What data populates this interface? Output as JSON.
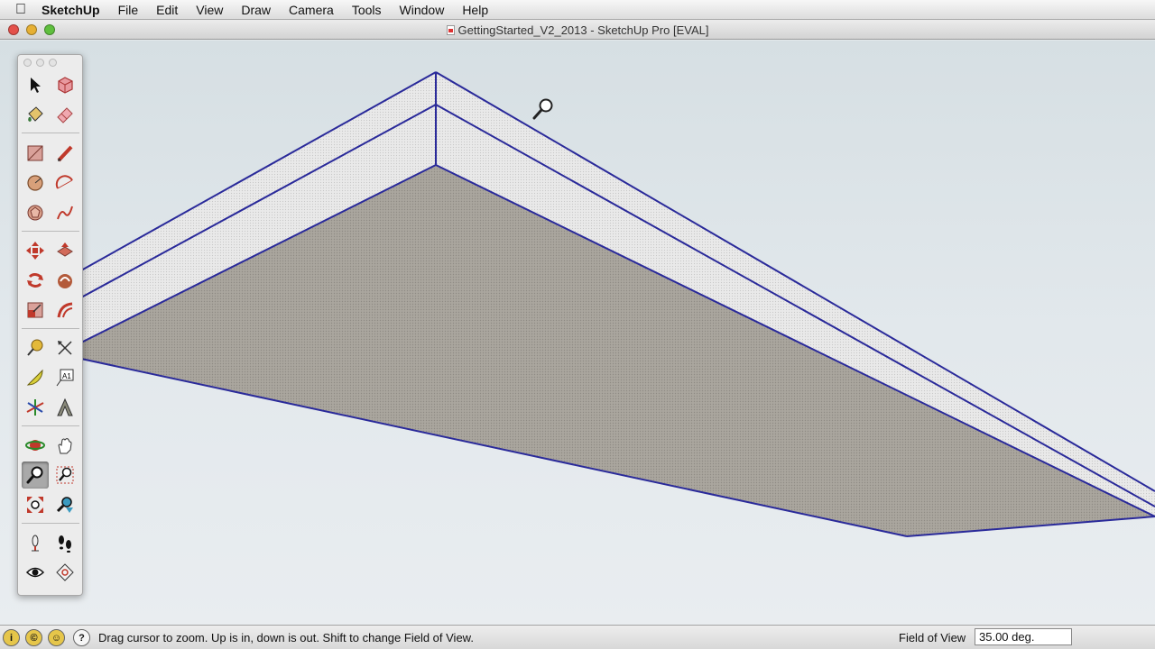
{
  "menubar": {
    "app_name": "SketchUp",
    "items": [
      "File",
      "Edit",
      "View",
      "Draw",
      "Camera",
      "Tools",
      "Window",
      "Help"
    ]
  },
  "window": {
    "title": "GettingStarted_V2_2013 - SketchUp Pro [EVAL]"
  },
  "palette": {
    "active_tool": "zoom-tool",
    "tools": [
      "select-tool",
      "make-component-tool",
      "paint-bucket-tool",
      "eraser-tool",
      "rectangle-tool",
      "line-tool",
      "circle-tool",
      "arc-tool",
      "polygon-tool",
      "freehand-tool",
      "move-tool",
      "push-pull-tool",
      "rotate-tool",
      "follow-me-tool",
      "scale-tool",
      "offset-tool",
      "tape-measure-tool",
      "dimension-tool",
      "protractor-tool",
      "text-tool",
      "axes-tool",
      "3d-text-tool",
      "orbit-tool",
      "pan-tool",
      "zoom-tool",
      "zoom-window-tool",
      "zoom-extents-tool",
      "previous-view-tool",
      "position-camera-tool",
      "walk-tool",
      "look-around-tool",
      "section-plane-tool"
    ]
  },
  "statusbar": {
    "message": "Drag cursor to zoom.  Up is in, down is out. Shift to change Field of View.",
    "fov_label": "Field of View",
    "fov_value": "35.00 deg."
  },
  "colors": {
    "edge": "#2a2a9a",
    "face_bottom": "#a7a39b",
    "face_side": "#e4e4e4",
    "sky": "#dae2e6"
  }
}
